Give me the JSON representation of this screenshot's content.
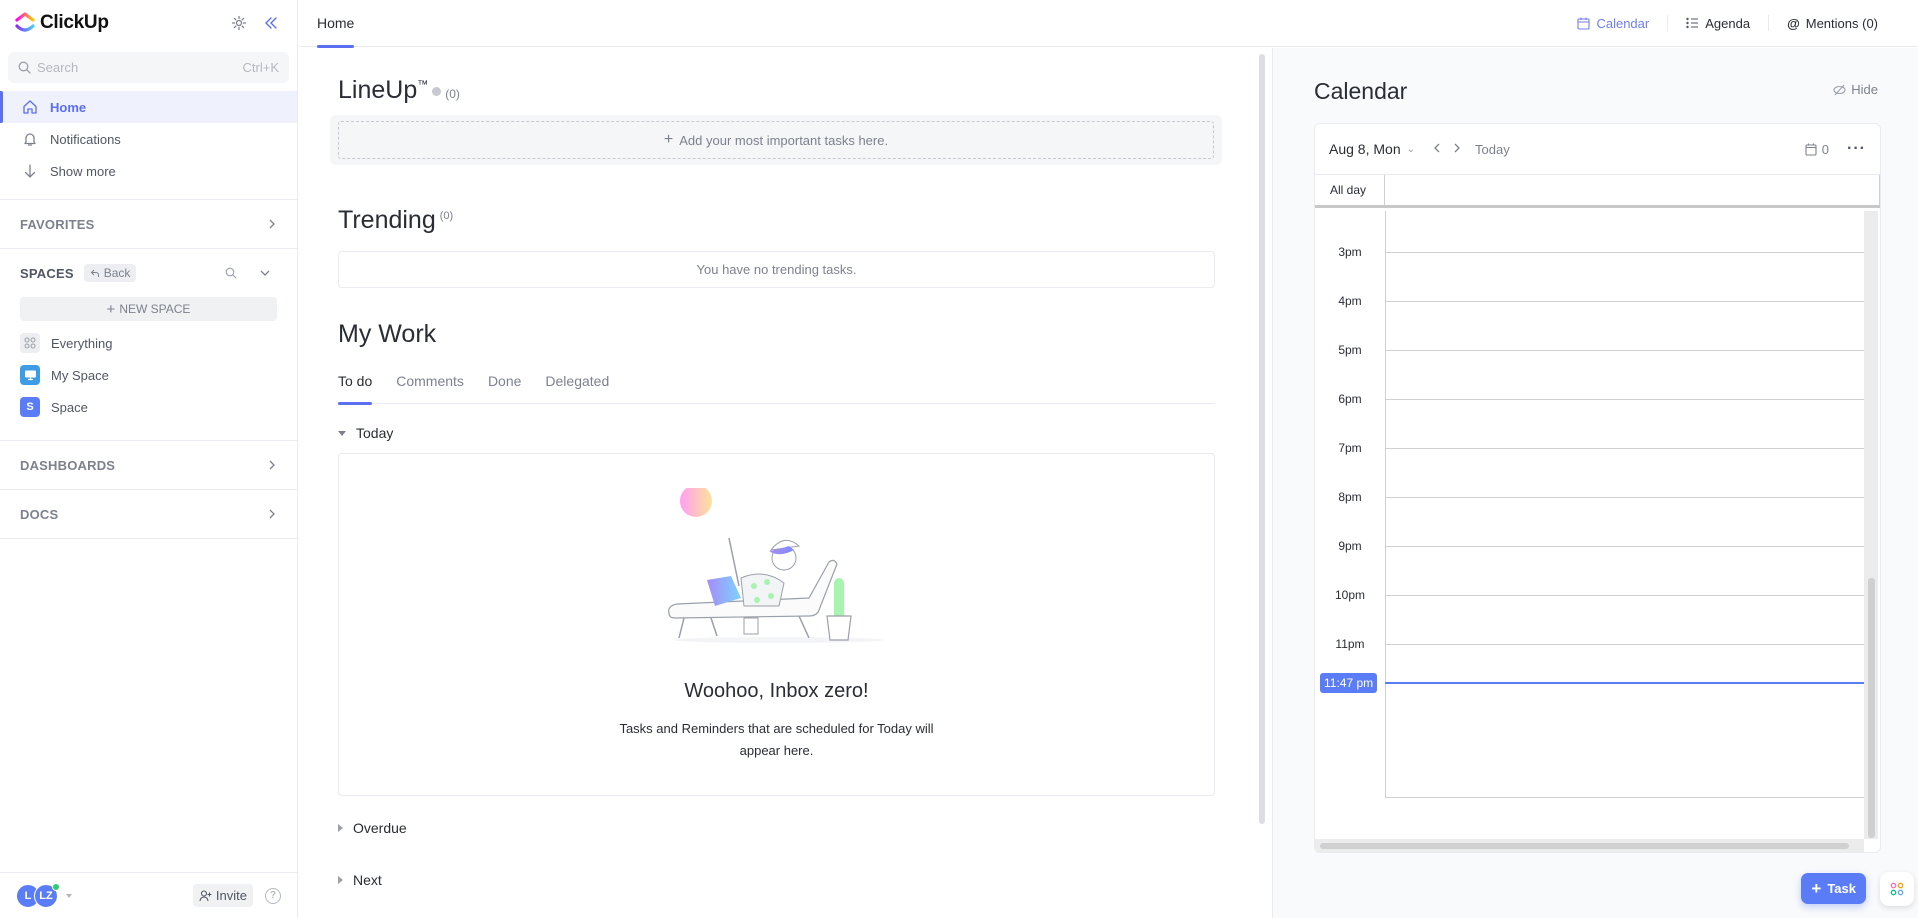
{
  "app": {
    "name": "ClickUp"
  },
  "sidebar": {
    "search": {
      "placeholder": "Search",
      "shortcut": "Ctrl+K"
    },
    "nav": [
      {
        "label": "Home",
        "icon": "home-icon",
        "active": true
      },
      {
        "label": "Notifications",
        "icon": "bell-icon",
        "active": false
      },
      {
        "label": "Show more",
        "icon": "arrow-down-icon",
        "active": false
      }
    ],
    "favorites_label": "FAVORITES",
    "spaces": {
      "title": "SPACES",
      "back_label": "Back",
      "new_space_label": "NEW SPACE",
      "items": [
        {
          "label": "Everything",
          "icon": "grid-icon",
          "color": "#eceef1"
        },
        {
          "label": "My Space",
          "icon": "monitor-icon",
          "color": "#3e9ce6"
        },
        {
          "label": "Space",
          "badge": "S",
          "color": "#5b7cf7"
        }
      ]
    },
    "dashboards_label": "DASHBOARDS",
    "docs_label": "DOCS",
    "footer": {
      "avatars": [
        "L",
        "LZ"
      ],
      "invite_label": "Invite",
      "help_label": "?"
    }
  },
  "topbar": {
    "tab": "Home",
    "links": [
      {
        "label": "Calendar",
        "icon": "calendar-icon",
        "active": true
      },
      {
        "label": "Agenda",
        "icon": "list-icon",
        "active": false
      },
      {
        "label": "Mentions (0)",
        "icon": "at-icon",
        "active": false
      }
    ]
  },
  "main": {
    "lineup": {
      "title": "LineUp",
      "tm": "™",
      "count": "(0)",
      "add_label": "Add your most important tasks here."
    },
    "trending": {
      "title": "Trending",
      "count": "(0)",
      "empty": "You have no trending tasks."
    },
    "mywork": {
      "title": "My Work",
      "tabs": [
        {
          "label": "To do",
          "active": true
        },
        {
          "label": "Comments",
          "active": false
        },
        {
          "label": "Done",
          "active": false
        },
        {
          "label": "Delegated",
          "active": false
        }
      ],
      "groups": {
        "today": "Today",
        "overdue": "Overdue",
        "next": "Next"
      },
      "empty_title": "Woohoo, Inbox zero!",
      "empty_sub_1": "Tasks and Reminders that are scheduled for Today will",
      "empty_sub_2": "appear here."
    }
  },
  "calendar": {
    "title": "Calendar",
    "hide_label": "Hide",
    "date_label": "Aug 8, Mon",
    "today_label": "Today",
    "event_count": "0",
    "allday_label": "All day",
    "hours": [
      "3pm",
      "4pm",
      "5pm",
      "6pm",
      "7pm",
      "8pm",
      "9pm",
      "10pm",
      "11pm"
    ],
    "now_label": "11:47 pm",
    "accent": "#5b7cf7"
  },
  "fab": {
    "task_label": "Task"
  }
}
